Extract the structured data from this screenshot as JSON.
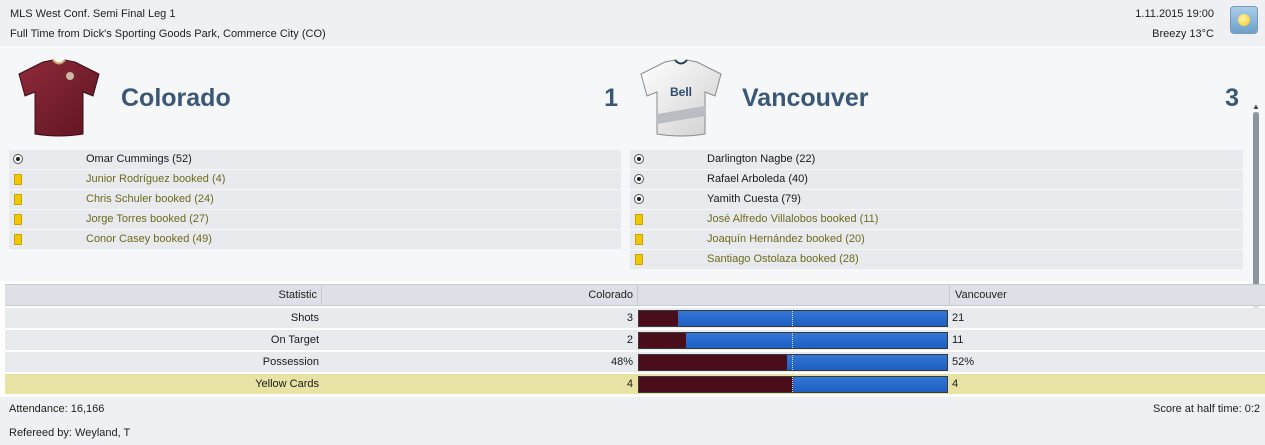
{
  "match": {
    "competition": "MLS West Conf. Semi Final Leg 1",
    "venue_line": "Full Time from Dick's Sporting Goods Park, Commerce City (CO)",
    "datetime": "1.11.2015 19:00",
    "weather": "Breezy 13°C",
    "weather_icon": "sunny-icon"
  },
  "home": {
    "name": "Colorado",
    "score": "1",
    "kit_color": "#7a1f2e",
    "events": [
      {
        "type": "goal",
        "icon": "ball-icon",
        "text": "Omar Cummings (52)"
      },
      {
        "type": "booking",
        "icon": "yellow-card-icon",
        "text": "Junior Rodríguez booked (4)"
      },
      {
        "type": "booking",
        "icon": "yellow-card-icon",
        "text": "Chris Schuler booked (24)"
      },
      {
        "type": "booking",
        "icon": "yellow-card-icon",
        "text": "Jorge Torres booked (27)"
      },
      {
        "type": "booking",
        "icon": "yellow-card-icon",
        "text": "Conor Casey booked (49)"
      }
    ]
  },
  "away": {
    "name": "Vancouver",
    "score": "3",
    "kit_color": "#e8e8e8",
    "kit_sponsor": "Bell",
    "events": [
      {
        "type": "goal",
        "icon": "ball-icon",
        "text": "Darlington Nagbe (22)"
      },
      {
        "type": "goal",
        "icon": "ball-icon",
        "text": "Rafael Arboleda (40)"
      },
      {
        "type": "goal",
        "icon": "ball-icon",
        "text": "Yamith Cuesta (79)"
      },
      {
        "type": "booking",
        "icon": "yellow-card-icon",
        "text": "José Alfredo Villalobos booked (11)"
      },
      {
        "type": "booking",
        "icon": "yellow-card-icon",
        "text": "Joaquín Hernández booked (20)"
      },
      {
        "type": "booking",
        "icon": "yellow-card-icon",
        "text": "Santiago Ostolaza booked (28)"
      }
    ]
  },
  "stats": {
    "header": {
      "statistic": "Statistic",
      "home": "Colorado",
      "away": "Vancouver"
    },
    "colors": {
      "home": "#4a0d1c",
      "away": "#1d5fc2",
      "highlight": "#e9e2a5"
    },
    "rows": [
      {
        "label": "Shots",
        "home_text": "3",
        "away_text": "21",
        "home_value": 3,
        "away_value": 21,
        "highlight": false
      },
      {
        "label": "On Target",
        "home_text": "2",
        "away_text": "11",
        "home_value": 2,
        "away_value": 11,
        "highlight": false
      },
      {
        "label": "Possession",
        "home_text": "48%",
        "away_text": "52%",
        "home_value": 48,
        "away_value": 52,
        "highlight": false
      },
      {
        "label": "Yellow Cards",
        "home_text": "4",
        "away_text": "4",
        "home_value": 4,
        "away_value": 4,
        "highlight": true
      }
    ]
  },
  "footer": {
    "attendance": "Attendance: 16,166",
    "referee": "Refereed by: Weyland, T",
    "half_time": "Score at half time: 0:2"
  }
}
